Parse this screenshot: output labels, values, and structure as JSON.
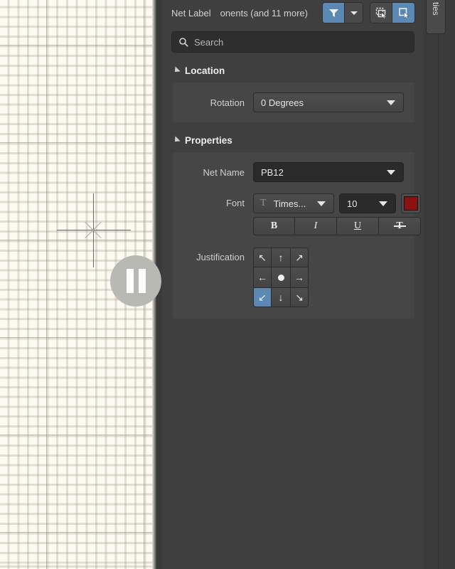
{
  "header": {
    "title": "Net Label",
    "subtitle": "onents (and 11 more)",
    "filter_icon": "filter-funnel-icon",
    "filter_dropdown_icon": "chevron-down-icon",
    "select_copy_icon": "select-copy-icon",
    "select_active_icon": "select-active-icon",
    "accent_color": "#5c89b4"
  },
  "search": {
    "icon": "search-icon",
    "placeholder": "Search",
    "value": ""
  },
  "sections": {
    "location": {
      "label": "Location",
      "collapse_icon": "triangle-expanded-icon",
      "rotation": {
        "label": "Rotation",
        "value": "0 Degrees",
        "dropdown_icon": "chevron-down-icon"
      }
    },
    "properties": {
      "label": "Properties",
      "collapse_icon": "triangle-expanded-icon",
      "net_name": {
        "label": "Net Name",
        "value": "PB12",
        "dropdown_icon": "chevron-down-icon"
      },
      "font": {
        "label": "Font",
        "family_icon": "text-glyph-icon",
        "family": "Times...",
        "family_dropdown_icon": "chevron-down-icon",
        "size": "10",
        "size_dropdown_icon": "chevron-down-icon",
        "color_swatch_name": "font-color-swatch",
        "color": "#8c1212",
        "styles": [
          {
            "name": "bold",
            "label": "B"
          },
          {
            "name": "italic",
            "label": "I"
          },
          {
            "name": "underline",
            "label": "U"
          },
          {
            "name": "strikethrough",
            "label": "T"
          }
        ]
      },
      "justification": {
        "label": "Justification",
        "cells": [
          {
            "name": "top-left",
            "icon": "arrow-up-left-icon",
            "glyph": "↖",
            "selected": false
          },
          {
            "name": "top-center",
            "icon": "arrow-up-icon",
            "glyph": "↑",
            "selected": false
          },
          {
            "name": "top-right",
            "icon": "arrow-up-right-icon",
            "glyph": "↗",
            "selected": false
          },
          {
            "name": "middle-left",
            "icon": "arrow-left-icon",
            "glyph": "←",
            "selected": false
          },
          {
            "name": "middle-center",
            "icon": "center-dot-icon",
            "glyph": "",
            "selected": false
          },
          {
            "name": "middle-right",
            "icon": "arrow-right-icon",
            "glyph": "→",
            "selected": false
          },
          {
            "name": "bottom-left",
            "icon": "arrow-down-left-icon",
            "glyph": "↙",
            "selected": true
          },
          {
            "name": "bottom-center",
            "icon": "arrow-down-icon",
            "glyph": "↓",
            "selected": false
          },
          {
            "name": "bottom-right",
            "icon": "arrow-down-right-icon",
            "glyph": "↘",
            "selected": false
          }
        ]
      }
    }
  },
  "right_tab": {
    "label": "ties"
  },
  "canvas": {
    "name": "schematic-canvas",
    "background": "#fdfaf2",
    "cursor_icon": "crosshair-cursor",
    "overlay_icon": "pause-icon"
  }
}
